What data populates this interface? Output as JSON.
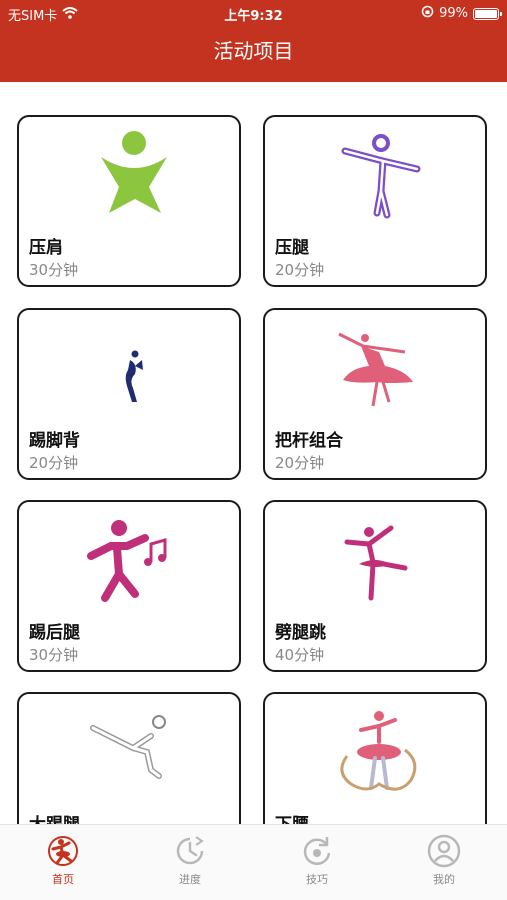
{
  "status_bar": {
    "carrier": "无SIM卡",
    "time": "上午9:32",
    "battery": "99%"
  },
  "header": {
    "title": "活动项目"
  },
  "activities": [
    {
      "name": "压肩",
      "duration": "30分钟",
      "icon": "cheer-figure-icon"
    },
    {
      "name": "压腿",
      "duration": "20分钟",
      "icon": "leg-stretch-figure-icon"
    },
    {
      "name": "踢脚背",
      "duration": "20分钟",
      "icon": "kick-figure-icon"
    },
    {
      "name": "把杆组合",
      "duration": "20分钟",
      "icon": "ballerina-figure-icon"
    },
    {
      "name": "踢后腿",
      "duration": "30分钟",
      "icon": "dance-music-figure-icon"
    },
    {
      "name": "劈腿跳",
      "duration": "40分钟",
      "icon": "leap-figure-icon"
    },
    {
      "name": "大踢腿",
      "duration": "",
      "icon": "high-kick-figure-icon"
    },
    {
      "name": "下腰",
      "duration": "",
      "icon": "ribbon-ballerina-icon"
    }
  ],
  "tabs": [
    {
      "label": "首页",
      "icon": "home-dancer-icon",
      "active": true
    },
    {
      "label": "进度",
      "icon": "progress-clock-icon",
      "active": false
    },
    {
      "label": "技巧",
      "icon": "tips-refresh-icon",
      "active": false
    },
    {
      "label": "我的",
      "icon": "profile-icon",
      "active": false
    }
  ],
  "colors": {
    "brand": "#c4331f",
    "active_tab": "#c4331f",
    "inactive_tab": "#8a8a8a"
  }
}
